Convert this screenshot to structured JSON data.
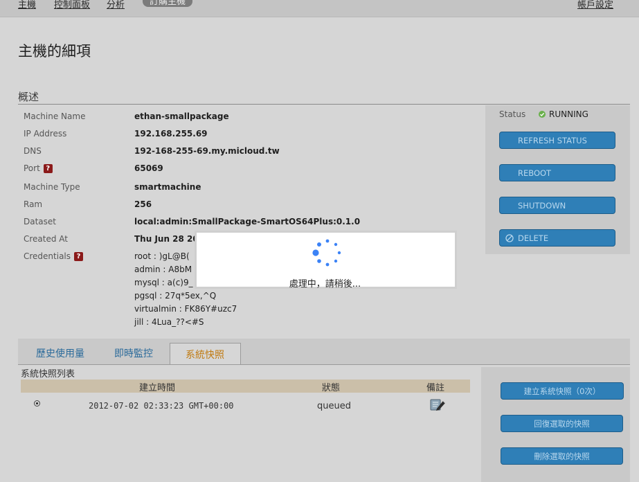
{
  "nav": {
    "items": [
      "主機",
      "控制面板",
      "分析"
    ],
    "active": "訂購主機",
    "account": "帳戶設定"
  },
  "page": {
    "title": "主機的細項",
    "section": "概述"
  },
  "details": [
    {
      "label": "Machine Name",
      "value": "ethan-smallpackage",
      "help": false
    },
    {
      "label": "IP Address",
      "value": "192.168.255.69",
      "help": false
    },
    {
      "label": "DNS",
      "value": "192-168-255-69.my.micloud.tw",
      "help": false
    },
    {
      "label": "Port",
      "value": "65069",
      "help": true
    },
    {
      "label": "Machine Type",
      "value": "smartmachine",
      "help": false
    },
    {
      "label": "Ram",
      "value": "256",
      "help": false
    },
    {
      "label": "Dataset",
      "value": "local:admin:SmallPackage-SmartOS64Plus:0.1.0",
      "help": false
    },
    {
      "label": "Created At",
      "value": "Thu Jun 28 20",
      "help": false
    }
  ],
  "credentials": {
    "label": "Credentials",
    "help_glyph": "?",
    "lines": [
      "root : )gL@B(",
      "admin : A8bM",
      "mysql : a(c)9_",
      "pgsql : 27q*5ex,^Q",
      "virtualmin : FK86Y#uzc7",
      "jill : 4Lua_??<#S"
    ]
  },
  "status": {
    "label": "Status",
    "value": "RUNNING",
    "color": "#6ab04c"
  },
  "actions": [
    "REFRESH STATUS",
    "REBOOT",
    "SHUTDOWN",
    "DELETE"
  ],
  "tabs": [
    "歷史使用量",
    "即時監控",
    "系統快照"
  ],
  "active_tab": "系統快照",
  "snapshots": {
    "title": "系統快照列表",
    "columns": [
      "建立時間",
      "狀態",
      "備註"
    ],
    "rows": [
      {
        "time": "2012-07-02 02:33:23 GMT+00:00",
        "status": "queued",
        "note_icon": "edit-note-icon"
      }
    ],
    "buttons": [
      "建立系統快照（0次）",
      "回復選取的快照",
      "刪除選取的快照"
    ]
  },
  "modal": {
    "text": "處理中，請稍後..."
  },
  "colors": {
    "button": "#2f7fb7",
    "button_text": "#b9d8ee",
    "active_tab_text": "#c07a10",
    "tab_text": "#2a6a9a",
    "spinner": "#3b82f6"
  }
}
